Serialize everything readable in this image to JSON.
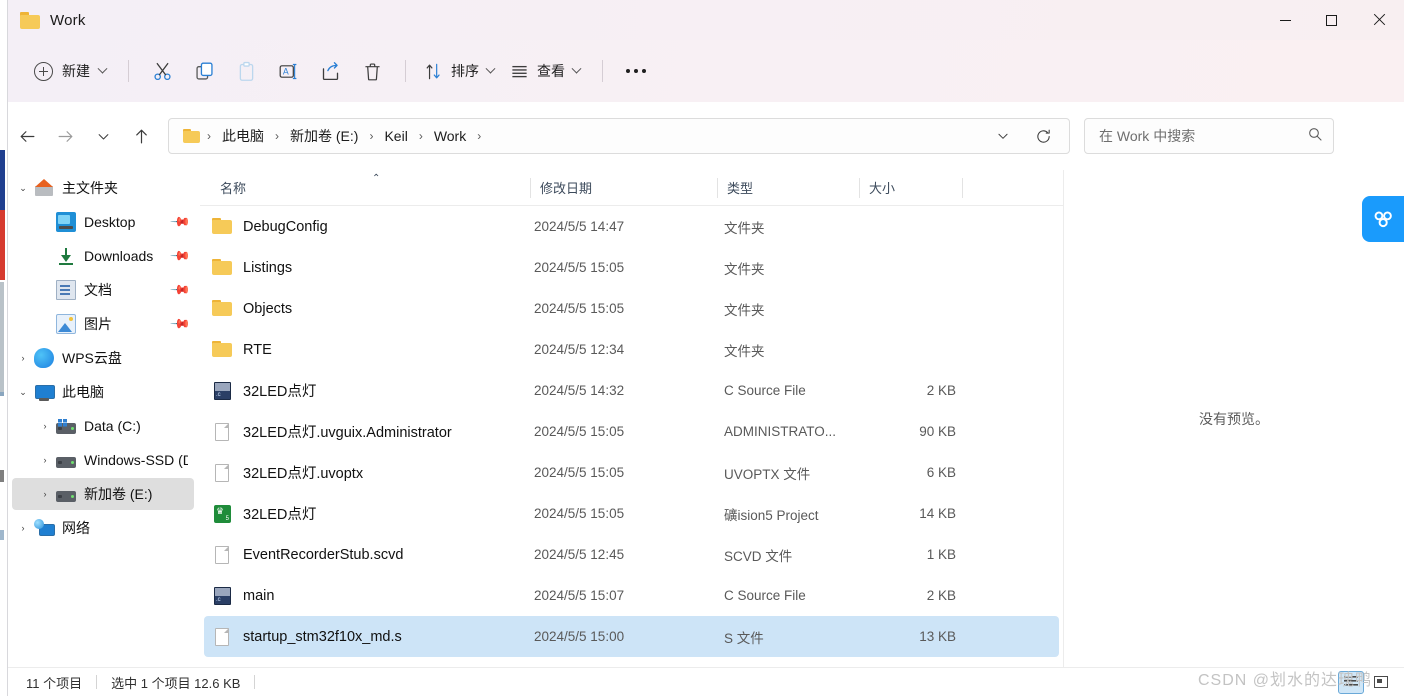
{
  "window": {
    "title": "Work",
    "folder_icon": "folder-icon",
    "controls": {
      "minimize": "—",
      "maximize": "□",
      "close": "✕"
    }
  },
  "toolbar": {
    "new_label": "新建",
    "cut_icon": "scissors-icon",
    "copy_icon": "copy-icon",
    "paste_icon": "paste-icon",
    "rename_icon": "rename-icon",
    "share_icon": "share-icon",
    "delete_icon": "trash-icon",
    "sort_label": "排序",
    "sort_icon": "sort-arrows-icon",
    "view_label": "查看",
    "view_icon": "view-lines-icon",
    "more_icon": "more-options-icon"
  },
  "addressbar": {
    "back_icon": "back-arrow-icon",
    "forward_icon": "forward-arrow-icon",
    "recent_icon": "chevron-down-icon",
    "up_icon": "up-arrow-icon",
    "crumbs": [
      "此电脑",
      "新加卷 (E:)",
      "Keil",
      "Work"
    ],
    "separator": "›",
    "dropdown_icon": "chevron-down-icon",
    "refresh_icon": "refresh-icon"
  },
  "search": {
    "placeholder": "在 Work 中搜索",
    "icon": "search-icon"
  },
  "sidebar": {
    "items": [
      {
        "label": "主文件夹",
        "icon": "home-icon",
        "caret": "⌄",
        "indent": 0,
        "pinned": false,
        "selected": false
      },
      {
        "label": "Desktop",
        "icon": "desktop-icon",
        "caret": "",
        "indent": 1,
        "pinned": true,
        "selected": false
      },
      {
        "label": "Downloads",
        "icon": "downloads-icon",
        "caret": "",
        "indent": 1,
        "pinned": true,
        "selected": false
      },
      {
        "label": "文档",
        "icon": "documents-icon",
        "caret": "",
        "indent": 1,
        "pinned": true,
        "selected": false
      },
      {
        "label": "图片",
        "icon": "pictures-icon",
        "caret": "",
        "indent": 1,
        "pinned": true,
        "selected": false
      },
      {
        "label": "WPS云盘",
        "icon": "wps-cloud-icon",
        "caret": "›",
        "indent": 0,
        "pinned": false,
        "selected": false
      },
      {
        "label": "此电脑",
        "icon": "this-pc-icon",
        "caret": "⌄",
        "indent": 0,
        "pinned": false,
        "selected": false
      },
      {
        "label": "Data (C:)",
        "icon": "drive-c-icon",
        "caret": "›",
        "indent": 1,
        "pinned": false,
        "selected": false
      },
      {
        "label": "Windows-SSD (D",
        "icon": "drive-icon",
        "caret": "›",
        "indent": 1,
        "pinned": false,
        "selected": false
      },
      {
        "label": "新加卷 (E:)",
        "icon": "drive-icon",
        "caret": "›",
        "indent": 1,
        "pinned": false,
        "selected": true
      },
      {
        "label": "网络",
        "icon": "network-icon",
        "caret": "›",
        "indent": 0,
        "pinned": false,
        "selected": false
      }
    ],
    "pin_icon": "pin-icon"
  },
  "filelist": {
    "columns": [
      {
        "label": "名称",
        "sorted": "asc",
        "sort_caret": "⌃"
      },
      {
        "label": "修改日期",
        "sorted": "",
        "sort_caret": ""
      },
      {
        "label": "类型",
        "sorted": "",
        "sort_caret": ""
      },
      {
        "label": "大小",
        "sorted": "",
        "sort_caret": ""
      }
    ],
    "rows": [
      {
        "name": "DebugConfig",
        "date": "2024/5/5 14:47",
        "type": "文件夹",
        "size": "",
        "icon": "folder-icon",
        "selected": false
      },
      {
        "name": "Listings",
        "date": "2024/5/5 15:05",
        "type": "文件夹",
        "size": "",
        "icon": "folder-icon",
        "selected": false
      },
      {
        "name": "Objects",
        "date": "2024/5/5 15:05",
        "type": "文件夹",
        "size": "",
        "icon": "folder-icon",
        "selected": false
      },
      {
        "name": "RTE",
        "date": "2024/5/5 12:34",
        "type": "文件夹",
        "size": "",
        "icon": "folder-icon",
        "selected": false
      },
      {
        "name": "32LED点灯",
        "date": "2024/5/5 14:32",
        "type": "C Source File",
        "size": "2 KB",
        "icon": "c-source-icon",
        "selected": false
      },
      {
        "name": "32LED点灯.uvguix.Administrator",
        "date": "2024/5/5 15:05",
        "type": "ADMINISTRATO...",
        "size": "90 KB",
        "icon": "generic-file-icon",
        "selected": false
      },
      {
        "name": "32LED点灯.uvoptx",
        "date": "2024/5/5 15:05",
        "type": "UVOPTX 文件",
        "size": "6 KB",
        "icon": "generic-file-icon",
        "selected": false
      },
      {
        "name": "32LED点灯",
        "date": "2024/5/5 15:05",
        "type": "礦ision5 Project",
        "size": "14 KB",
        "icon": "keil-project-icon",
        "selected": false
      },
      {
        "name": "EventRecorderStub.scvd",
        "date": "2024/5/5 12:45",
        "type": "SCVD 文件",
        "size": "1 KB",
        "icon": "generic-file-icon",
        "selected": false
      },
      {
        "name": "main",
        "date": "2024/5/5 15:07",
        "type": "C Source File",
        "size": "2 KB",
        "icon": "c-source-icon",
        "selected": false
      },
      {
        "name": "startup_stm32f10x_md.s",
        "date": "2024/5/5 15:00",
        "type": "S 文件",
        "size": "13 KB",
        "icon": "generic-file-icon",
        "selected": true
      }
    ]
  },
  "preview": {
    "empty_text": "没有预览。"
  },
  "statusbar": {
    "item_count": "11 个项目",
    "selection": "选中 1 个项目  12.6 KB",
    "details_view_icon": "details-view-icon",
    "large-icons_view_icon": "large-icons-view-icon"
  },
  "watermark": {
    "text": "CSDN @划水的达瑰鸭"
  },
  "netdisk": {
    "icon": "baidu-netdisk-icon"
  },
  "colors": {
    "accent": "#1a9bfc",
    "selection": "#cde4f7",
    "titlebar": "#f6eff4",
    "folder": "#f6ca58"
  }
}
